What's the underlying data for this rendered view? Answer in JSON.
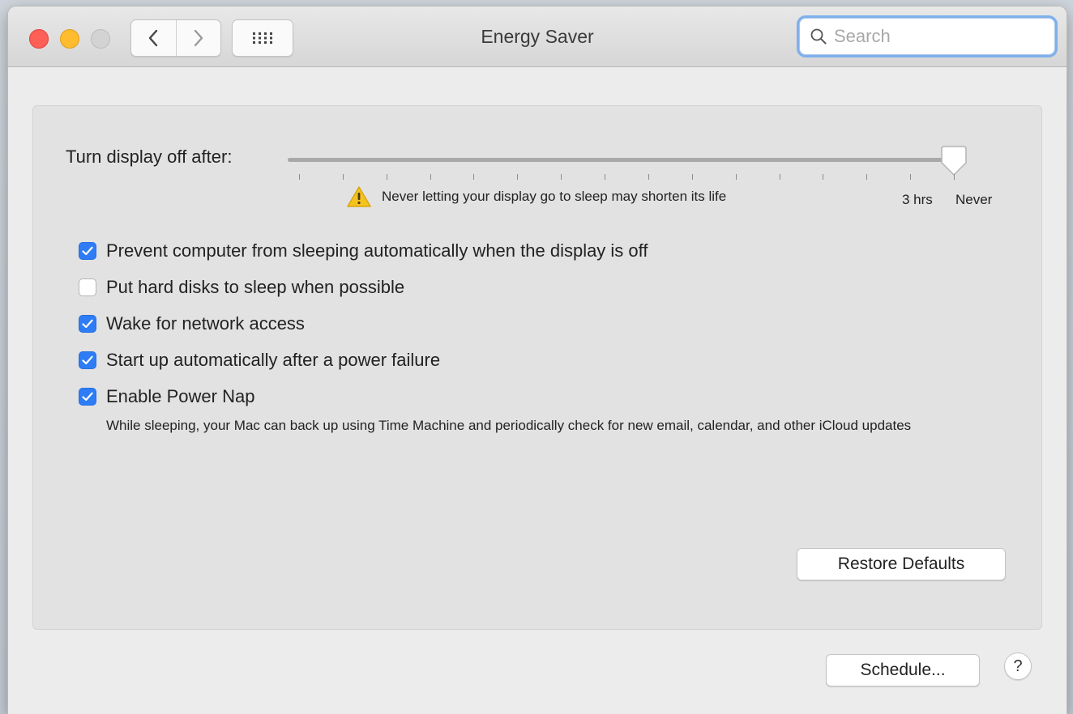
{
  "window": {
    "title": "Energy Saver"
  },
  "toolbar": {
    "back_icon": "chevron-left-icon",
    "forward_icon": "chevron-right-icon",
    "show_all_icon": "grid-icon",
    "search_placeholder": "Search",
    "search_value": ""
  },
  "display_sleep": {
    "label": "Turn display off after:",
    "selected_value": "Never",
    "slider_fraction": 1.0,
    "tick_count": 16,
    "warning_icon": "warning-triangle-icon",
    "warning_text": "Never letting your display go to sleep may shorten its life",
    "tick_labels": [
      "3 hrs",
      "Never"
    ]
  },
  "options": [
    {
      "label": "Prevent computer from sleeping automatically when the display is off",
      "checked": true
    },
    {
      "label": "Put hard disks to sleep when possible",
      "checked": false
    },
    {
      "label": "Wake for network access",
      "checked": true
    },
    {
      "label": "Start up automatically after a power failure",
      "checked": true
    },
    {
      "label": "Enable Power Nap",
      "checked": true
    }
  ],
  "power_nap_description": "While sleeping, your Mac can back up using Time Machine and periodically check for new email, calendar, and other iCloud updates",
  "buttons": {
    "restore_defaults": "Restore Defaults",
    "schedule": "Schedule...",
    "help": "?"
  },
  "colors": {
    "accent": "#2e7cf6",
    "close": "#fe5f57",
    "minimize": "#febc2e",
    "zoom_disabled": "#d3d3d3",
    "warning": "#f5c31d"
  }
}
